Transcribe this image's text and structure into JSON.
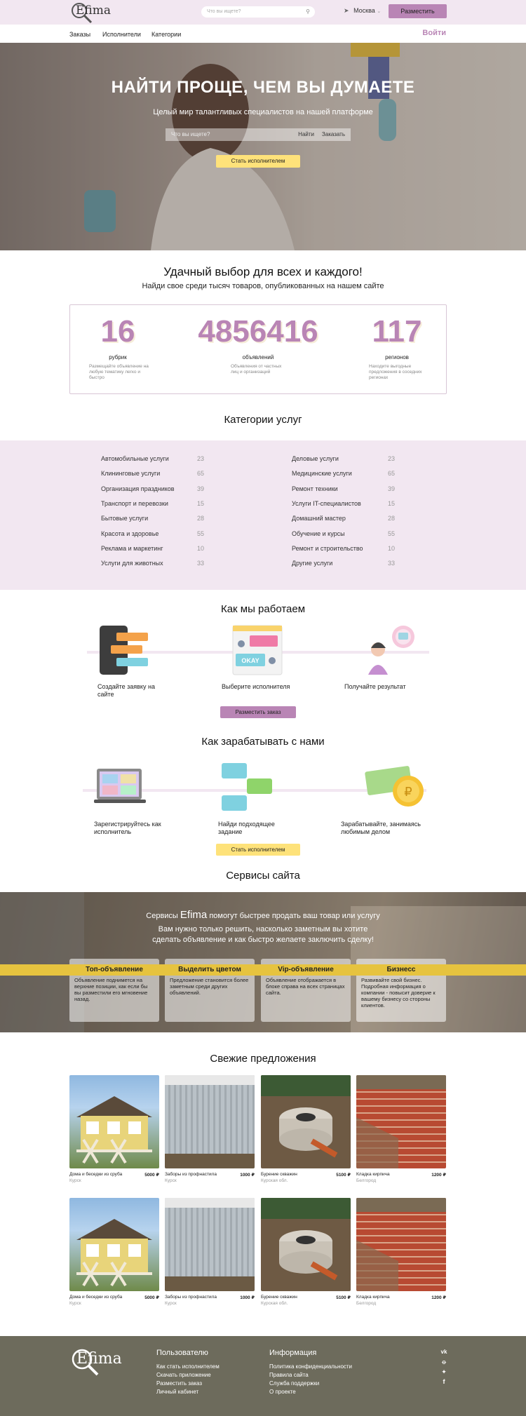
{
  "header": {
    "logo": "Efima",
    "search_placeholder": "Что вы ищете?",
    "city": "Москва",
    "post_button": "Разместить"
  },
  "nav": {
    "items": [
      "Заказы",
      "Исполнители",
      "Категории"
    ],
    "login": "Войти"
  },
  "hero": {
    "title": "НАЙТИ ПРОЩЕ, ЧЕМ ВЫ ДУМАЕТЕ",
    "subtitle": "Целый мир талантливых специалистов на нашей платформе",
    "search_placeholder": "Что вы ищете?",
    "find": "Найти",
    "order": "Заказать",
    "become_button": "Стать исполнителем"
  },
  "stats": {
    "title": "Удачный выбор для всех и каждого!",
    "subtitle": "Найди свое среди тысяч товаров, опубликованных на нашем сайте",
    "items": [
      {
        "value": "16",
        "label": "рубрик",
        "desc": "Размещайте объявление на любую тематику легко и быстро"
      },
      {
        "value": "4856416",
        "label": "объявлений",
        "desc": "Объявления от частных лиц и организаций"
      },
      {
        "value": "117",
        "label": "регионов",
        "desc": "Находите выгодные предложения в соседних регионах"
      }
    ]
  },
  "categories": {
    "title": "Категории услуг",
    "left": [
      {
        "name": "Автомобильные услуги",
        "count": "23"
      },
      {
        "name": "Клининговые услуги",
        "count": "65"
      },
      {
        "name": "Организация праздников",
        "count": "39"
      },
      {
        "name": "Транспорт и перевозки",
        "count": "15"
      },
      {
        "name": "Бытовые услуги",
        "count": "28"
      },
      {
        "name": "Красота и здоровье",
        "count": "55"
      },
      {
        "name": "Реклама и маркетинг",
        "count": "10"
      },
      {
        "name": "Услуги для животных",
        "count": "33"
      }
    ],
    "right": [
      {
        "name": "Деловые услуги",
        "count": "23"
      },
      {
        "name": "Медицинские услуги",
        "count": "65"
      },
      {
        "name": "Ремонт техники",
        "count": "39"
      },
      {
        "name": "Услуги IT-специалистов",
        "count": "15"
      },
      {
        "name": "Домашний мастер",
        "count": "28"
      },
      {
        "name": "Обучение и курсы",
        "count": "55"
      },
      {
        "name": "Ремонт и строительство",
        "count": "10"
      },
      {
        "name": "Другие услуги",
        "count": "33"
      }
    ]
  },
  "how": {
    "title": "Как мы работаем",
    "steps": [
      "Создайте заявку на сайте",
      "Выберите исполнителя",
      "Получайте результат"
    ],
    "okay": "OKAY",
    "button": "Разместить заказ"
  },
  "earn": {
    "title": "Как зарабатывать с нами",
    "steps": [
      "Зарегистрируйтесь как исполнитель",
      "Найди подходящее задание",
      "Зарабатывайте, занимаясь любимым делом"
    ],
    "button": "Стать исполнителем"
  },
  "services": {
    "title": "Сервисы сайта",
    "line1_pre": "Сервисы",
    "line1_brand": "Efima",
    "line1_post": "помогут быстрее продать ваш товар или услугу",
    "line2": "Вам нужно только решить, насколько заметным  вы хотите",
    "line3": "сделать объявление и как быстро желаете заключить сделку!",
    "cards": [
      {
        "title": "Топ-объявление",
        "desc": "Объявление поднимется на верхние позиции, как если бы вы разместили его мгновение назад."
      },
      {
        "title": "Выделить цветом",
        "desc": "Предложение становится более заметным среди других объявлений."
      },
      {
        "title": "Vip-объявление",
        "desc": "Объявление отображается в блоке справа на всех страницах сайта."
      },
      {
        "title": "Бизнесс",
        "desc": "Развивайте свой бизнес. Подробная информация о компании - повысит доверие к вашему бизнесу со стороны клиентов."
      }
    ]
  },
  "offers": {
    "title": "Свежие предложения",
    "items": [
      {
        "title": "Дома и беседки из сруба",
        "price": "5000 ₽",
        "city": "Курск"
      },
      {
        "title": "Заборы из профнастила",
        "price": "1000 ₽",
        "city": "Курск"
      },
      {
        "title": "Бурение скважин",
        "price": "5100 ₽",
        "city": "Курская обл."
      },
      {
        "title": "Кладка кирпича",
        "price": "1200 ₽",
        "city": "Белгород"
      },
      {
        "title": "Дома и беседки из сруба",
        "price": "5000 ₽",
        "city": "Курск"
      },
      {
        "title": "Заборы из профнастила",
        "price": "1000 ₽",
        "city": "Курск"
      },
      {
        "title": "Бурение скважин",
        "price": "5100 ₽",
        "city": "Курская обл."
      },
      {
        "title": "Кладка кирпича",
        "price": "1200 ₽",
        "city": "Белгород"
      }
    ]
  },
  "footer": {
    "logo": "Efima",
    "users_title": "Пользователю",
    "users_links": [
      "Как стать исполнителем",
      "Скачать приложение",
      "Разместить заказ",
      "Личный кабинет"
    ],
    "info_title": "Информация",
    "info_links": [
      "Политика конфиденциальности",
      "Правила сайта",
      "Служба поддержки",
      "О проекте"
    ],
    "social_icons": [
      "vk-icon",
      "odnoklassniki-icon",
      "twitter-icon",
      "facebook-icon"
    ]
  },
  "colors": {
    "accent": "#b985b5",
    "yellow": "#fee27a",
    "lilac_bg": "#f2e7f1",
    "footer": "#6d6b5c"
  }
}
